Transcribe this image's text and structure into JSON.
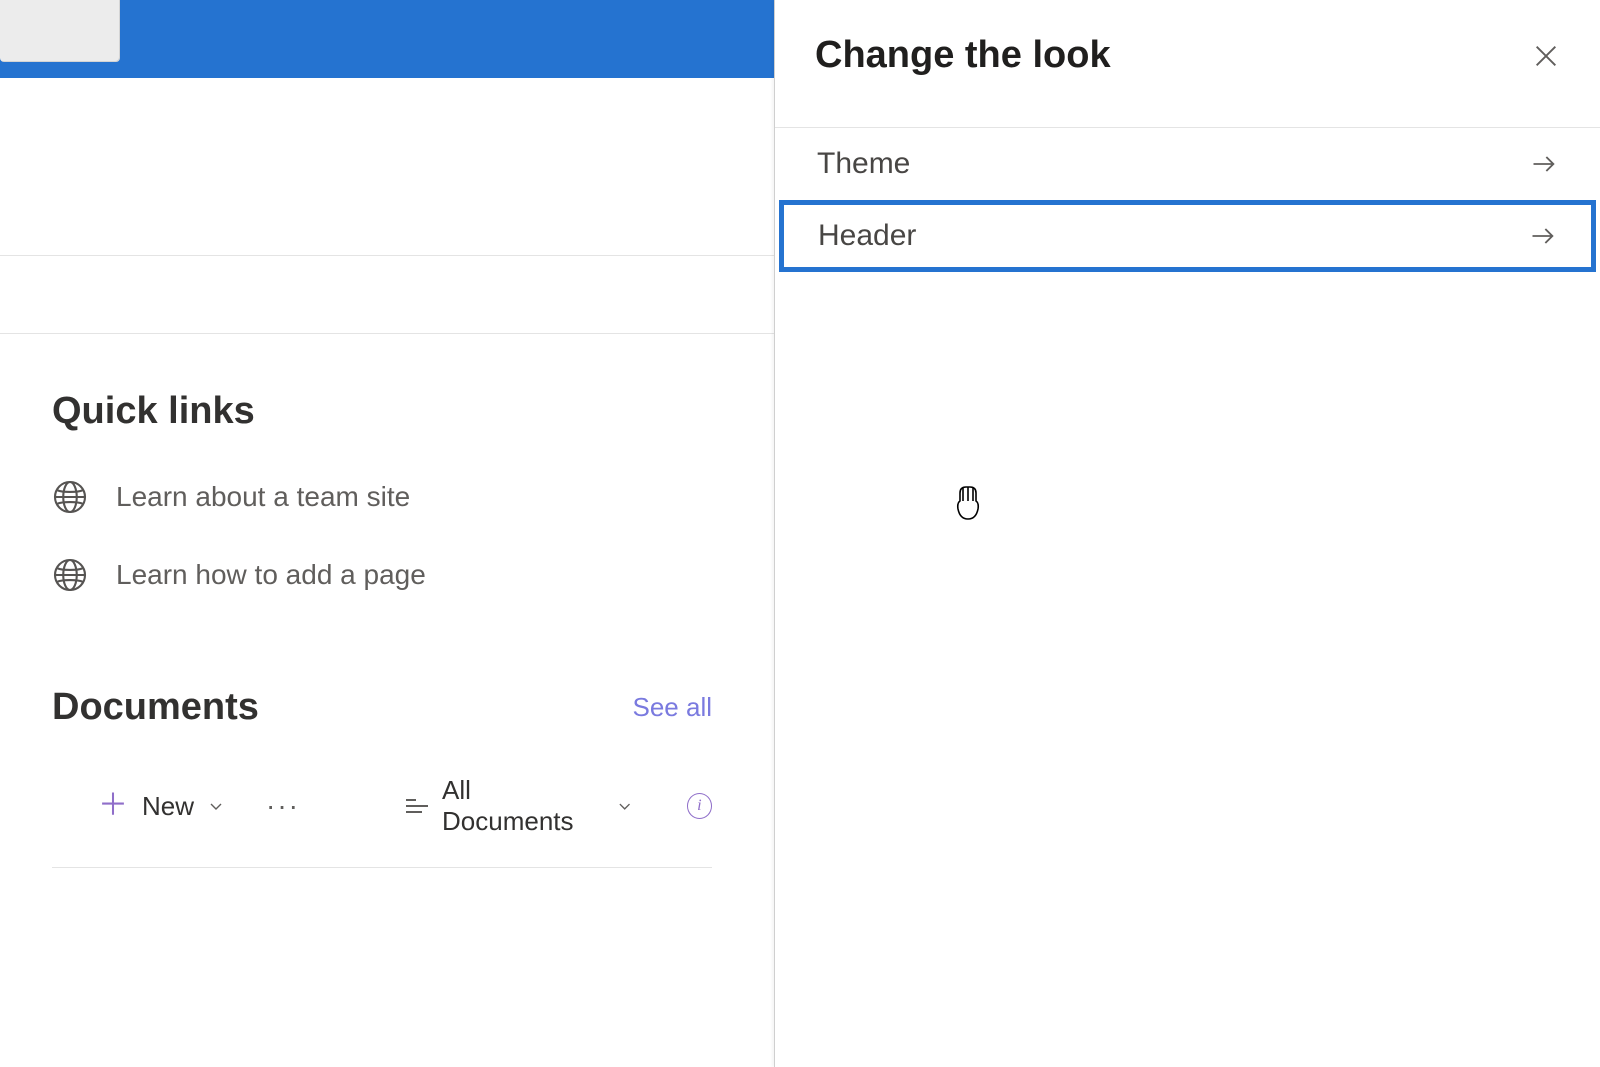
{
  "main": {
    "quick_links": {
      "title": "Quick links",
      "items": [
        {
          "label": "Learn about a team site"
        },
        {
          "label": "Learn how to add a page"
        }
      ]
    },
    "documents": {
      "title": "Documents",
      "see_all": "See all",
      "new_label": "New",
      "view_label": "All Documents"
    }
  },
  "panel": {
    "title": "Change the look",
    "items": [
      {
        "label": "Theme"
      },
      {
        "label": "Header"
      }
    ]
  }
}
